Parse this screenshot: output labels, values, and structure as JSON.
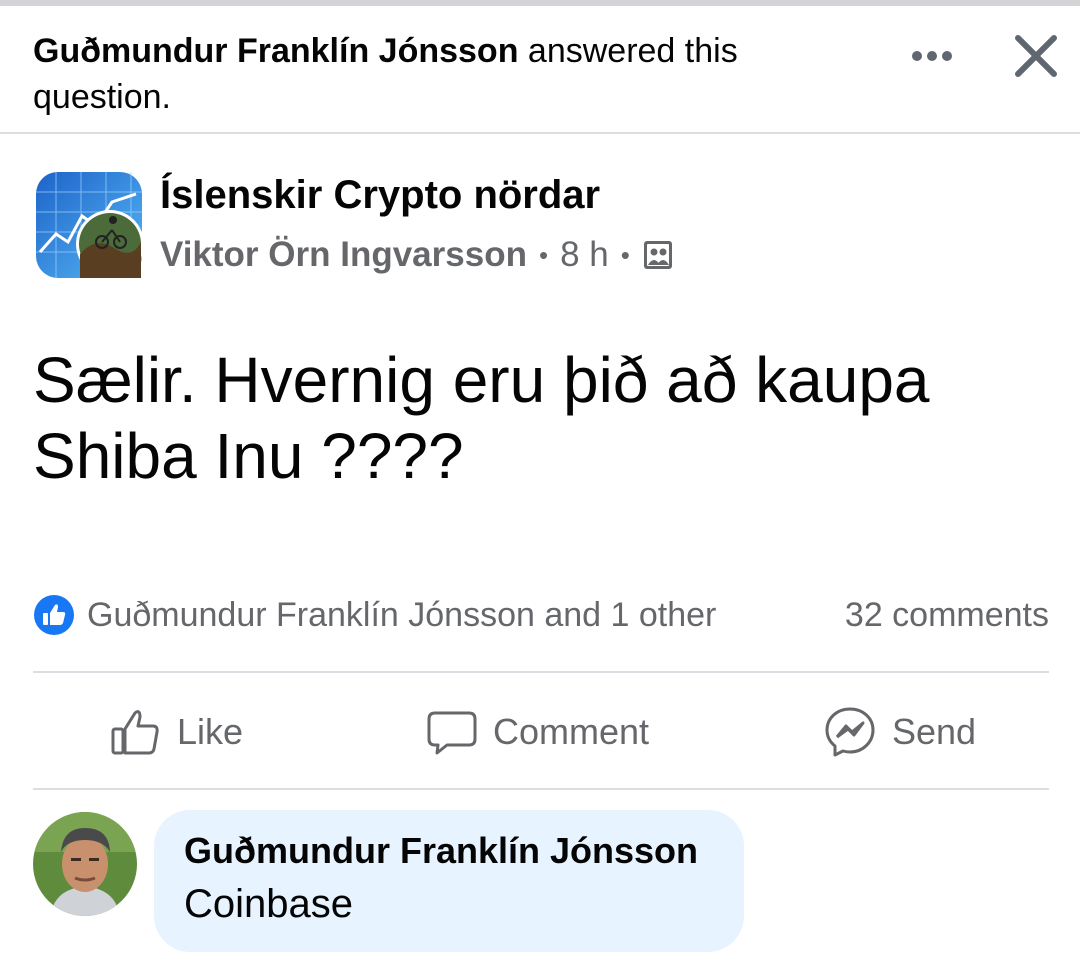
{
  "notice": {
    "actor": "Guðmundur Franklín Jónsson",
    "action_line1": " answered this",
    "action_line2": "question."
  },
  "header_icons": {
    "more": "more-icon",
    "close": "close-icon"
  },
  "post": {
    "group_name": "Íslenskir Crypto nördar",
    "author": "Viktor Örn Ingvarsson",
    "separator": "•",
    "time": "8 h",
    "audience_icon": "group-audience-icon",
    "text_line1": "Sælir. Hvernig eru þið að kaupa",
    "text_line2": "Shiba Inu ????"
  },
  "reactions": {
    "summary": "Guðmundur Franklín Jónsson and 1 other",
    "comments_count": "32 comments"
  },
  "actions": {
    "like": "Like",
    "comment": "Comment",
    "send": "Send"
  },
  "comment": {
    "author": "Guðmundur Franklín Jónsson",
    "text": "Coinbase"
  },
  "colors": {
    "like_blue": "#1877f2",
    "secondary_text": "#65676b",
    "comment_bubble": "#e7f3ff",
    "divider": "#dadde1"
  }
}
